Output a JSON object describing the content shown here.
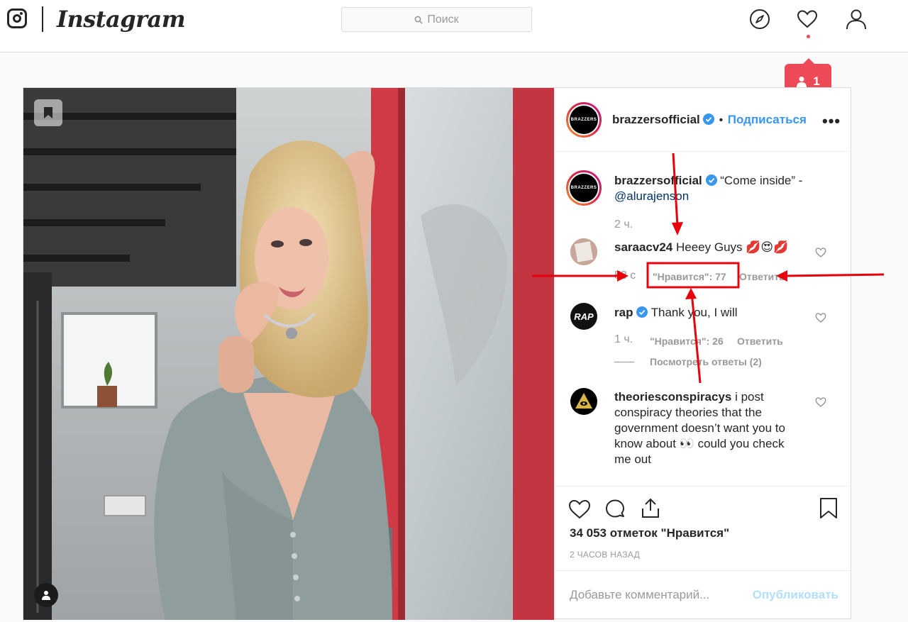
{
  "header": {
    "wordmark": "Instagram",
    "search_placeholder": "Поиск",
    "notification_count": "1"
  },
  "post": {
    "author": "brazzersofficial",
    "avatar_text": "BRAZZERS",
    "dot": "•",
    "follow_label": "Подписаться",
    "more_label": "•••",
    "caption_author": "brazzersofficial",
    "caption_text": "“Come inside” -",
    "caption_mention": "@alurajenson",
    "caption_time": "2 ч.",
    "comments": [
      {
        "user": "saraacv24",
        "text": "Heeey Guys 💋😍💋",
        "time": "53 с",
        "likes": "\"Нравится\": 77",
        "reply": "Ответить"
      },
      {
        "user": "rap",
        "text": "Thank you, I will",
        "avatar_text": "RAP",
        "time": "1 ч.",
        "likes": "\"Нравится\": 26",
        "reply": "Ответить",
        "view_replies": "Посмотреть ответы (2)"
      },
      {
        "user": "theoriesconspiracys",
        "text": "i post conspiracy theories that the government doesn’t want you to know about 👀 could you check me out"
      }
    ],
    "likes_count": "34 053 отметок \"Нравится\"",
    "posted_ago": "2 ЧАСОВ НАЗАД",
    "add_comment_placeholder": "Добавьте комментарий...",
    "publish_label": "Опубликовать"
  },
  "colors": {
    "link": "#3897f0",
    "notification": "#ed4956",
    "annotation": "#e8000b"
  }
}
